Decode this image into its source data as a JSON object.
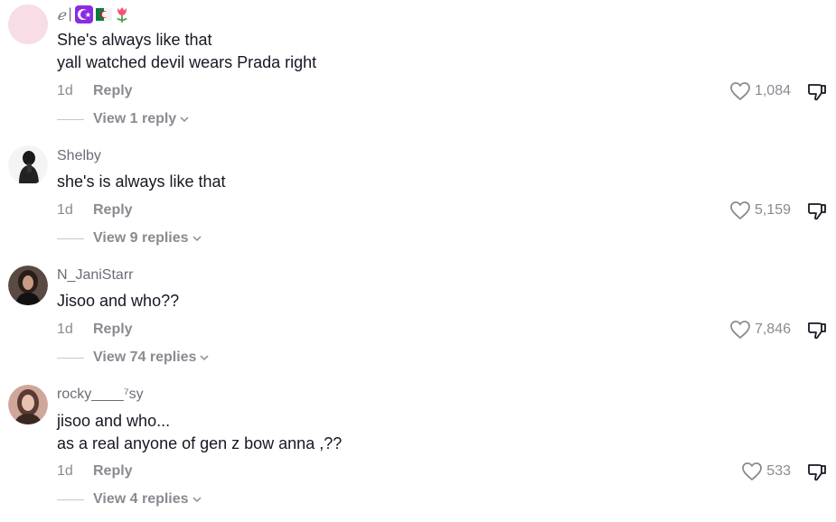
{
  "comments": [
    {
      "username": "ℯ",
      "lines": [
        "She's always like that",
        "yall watched devil wears Prada right"
      ],
      "date": "1d",
      "reply_label": "Reply",
      "view_replies": "View 1 reply",
      "likes": "1,084",
      "avatar_color": "#f8dce6"
    },
    {
      "username": "Shelby",
      "lines": [
        "she's is always like that"
      ],
      "date": "1d",
      "reply_label": "Reply",
      "view_replies": "View 9 replies",
      "likes": "5,159"
    },
    {
      "username": "N_JaniStarr",
      "lines": [
        "Jisoo and who??"
      ],
      "date": "1d",
      "reply_label": "Reply",
      "view_replies": "View 74 replies",
      "likes": "7,846"
    },
    {
      "username": "rocky____⁷sy",
      "lines": [
        "jisoo and who...",
        "as a real anyone of gen z bow anna ,??"
      ],
      "date": "1d",
      "reply_label": "Reply",
      "view_replies": "View 4 replies",
      "likes": "533"
    }
  ],
  "icons": {
    "like": "heart-icon",
    "dislike": "thumbs-down-icon",
    "expand": "chevron-down-icon",
    "username_badges": [
      "crescent-moon-icon",
      "algeria-flag-icon",
      "tulip-icon"
    ]
  },
  "colors": {
    "muted_text": "#8a8b91",
    "body_text": "#161823",
    "badge_purple": "#8a2be2"
  }
}
